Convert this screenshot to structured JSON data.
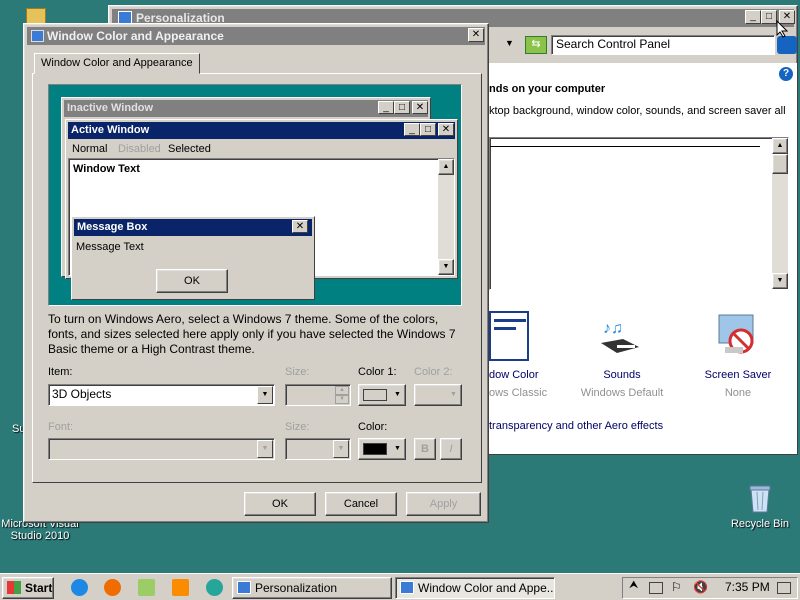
{
  "desktop": {
    "icons": [
      {
        "label": "Microsoft Visual Studio 2010"
      },
      {
        "label": "Recycle Bin"
      }
    ],
    "partial_label": "Su"
  },
  "personalization": {
    "title": "Personalization",
    "search_placeholder": "Search Control Panel",
    "heading": "nds on your computer",
    "description": "ktop background, window color, sounds, and screen saver all",
    "items": [
      {
        "label": "dow Color",
        "sub": "ows Classic"
      },
      {
        "label": "Sounds",
        "sub": "Windows Default"
      },
      {
        "label": "Screen Saver",
        "sub": "None"
      }
    ],
    "aero_link": "transparency and other Aero effects"
  },
  "dialog": {
    "title": "Window Color and Appearance",
    "tab": "Window Color and Appearance",
    "preview": {
      "inactive_title": "Inactive Window",
      "active_title": "Active Window",
      "menu": [
        "Normal",
        "Disabled",
        "Selected"
      ],
      "window_text": "Window Text",
      "msgbox_title": "Message Box",
      "msgbox_text": "Message Text",
      "msgbox_ok": "OK"
    },
    "info_text": "To turn on Windows Aero, select a Windows 7 theme.  Some of the colors, fonts, and sizes selected here apply only if you have selected the Windows 7 Basic theme or a High Contrast theme.",
    "item_label": "Item:",
    "item_value": "3D Objects",
    "size_label": "Size:",
    "color1_label": "Color 1:",
    "color2_label": "Color 2:",
    "font_label": "Font:",
    "font_size_label": "Size:",
    "font_color_label": "Color:",
    "bold_label": "B",
    "italic_label": "I",
    "buttons": {
      "ok": "OK",
      "cancel": "Cancel",
      "apply": "Apply"
    },
    "colors": {
      "color1": "#d4d0c8",
      "font_color": "#000000"
    }
  },
  "taskbar": {
    "start": "Start",
    "tasks": [
      {
        "label": "Personalization"
      },
      {
        "label": "Window Color and Appe..."
      }
    ],
    "clock": "7:35 PM"
  },
  "colors": {
    "desktop": "#2b7a78",
    "active_title": "#0a246a",
    "inactive_title": "#808080",
    "preview_bg": "#008080"
  }
}
